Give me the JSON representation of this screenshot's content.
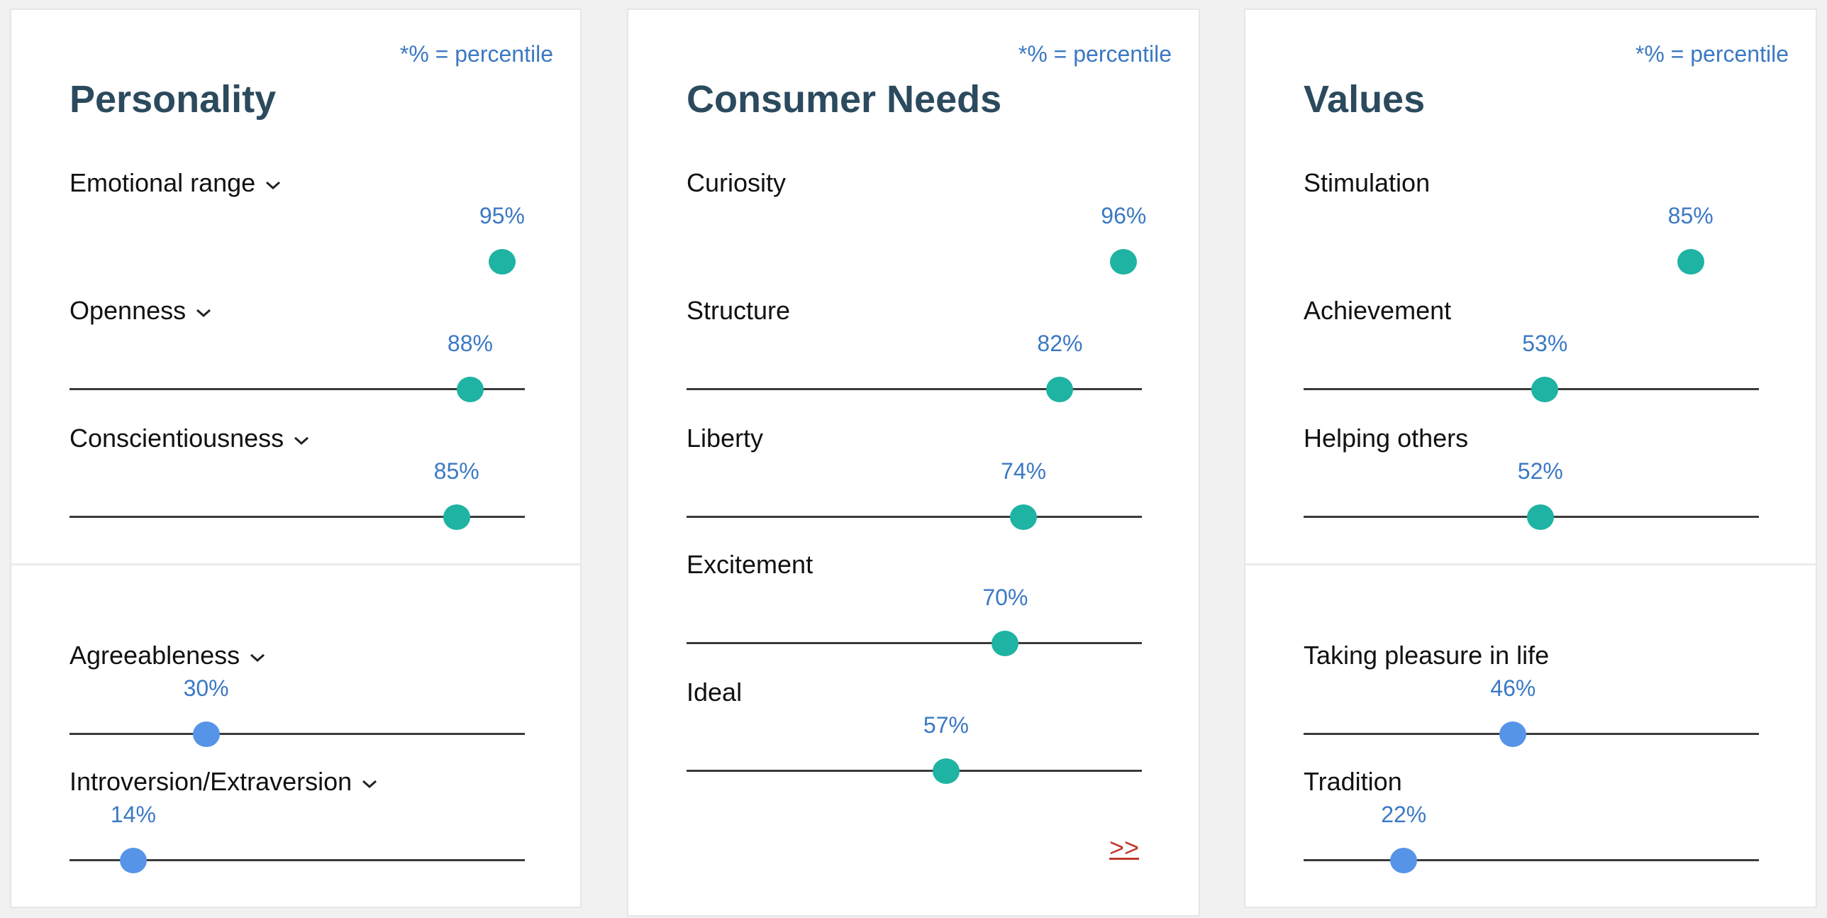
{
  "percentile_note": "*% = percentile",
  "personality": {
    "title": "Personality",
    "traits": [
      {
        "label": "Emotional range",
        "percent": 95,
        "display": "95%",
        "has_track": false,
        "color": "teal"
      },
      {
        "label": "Openness",
        "percent": 88,
        "display": "88%",
        "has_track": true,
        "color": "teal"
      },
      {
        "label": "Conscientiousness",
        "percent": 85,
        "display": "85%",
        "has_track": true,
        "color": "teal"
      },
      {
        "label": "Agreeableness",
        "percent": 30,
        "display": "30%",
        "has_track": true,
        "color": "blue"
      },
      {
        "label": "Introversion/Extraversion",
        "percent": 14,
        "display": "14%",
        "has_track": true,
        "color": "blue"
      }
    ]
  },
  "consumer_needs": {
    "title": "Consumer Needs",
    "traits": [
      {
        "label": "Curiosity",
        "percent": 96,
        "display": "96%",
        "has_track": false,
        "color": "teal"
      },
      {
        "label": "Structure",
        "percent": 82,
        "display": "82%",
        "has_track": true,
        "color": "teal"
      },
      {
        "label": "Liberty",
        "percent": 74,
        "display": "74%",
        "has_track": true,
        "color": "teal"
      },
      {
        "label": "Excitement",
        "percent": 70,
        "display": "70%",
        "has_track": true,
        "color": "teal"
      },
      {
        "label": "Ideal",
        "percent": 57,
        "display": "57%",
        "has_track": true,
        "color": "teal"
      }
    ],
    "more_link": ">>"
  },
  "values": {
    "title": "Values",
    "traits": [
      {
        "label": "Stimulation",
        "percent": 85,
        "display": "85%",
        "has_track": false,
        "color": "teal"
      },
      {
        "label": "Achievement",
        "percent": 53,
        "display": "53%",
        "has_track": true,
        "color": "teal"
      },
      {
        "label": "Helping others",
        "percent": 52,
        "display": "52%",
        "has_track": true,
        "color": "teal"
      },
      {
        "label": "Taking pleasure in life",
        "percent": 46,
        "display": "46%",
        "has_track": true,
        "color": "blue"
      },
      {
        "label": "Tradition",
        "percent": 22,
        "display": "22%",
        "has_track": true,
        "color": "blue"
      }
    ]
  },
  "colors": {
    "accent_teal": "#1eb3a2",
    "accent_blue": "#5694e8",
    "percent_text": "#3b79c3",
    "title_text": "#2b4a5e",
    "link_red": "#c0392b"
  }
}
